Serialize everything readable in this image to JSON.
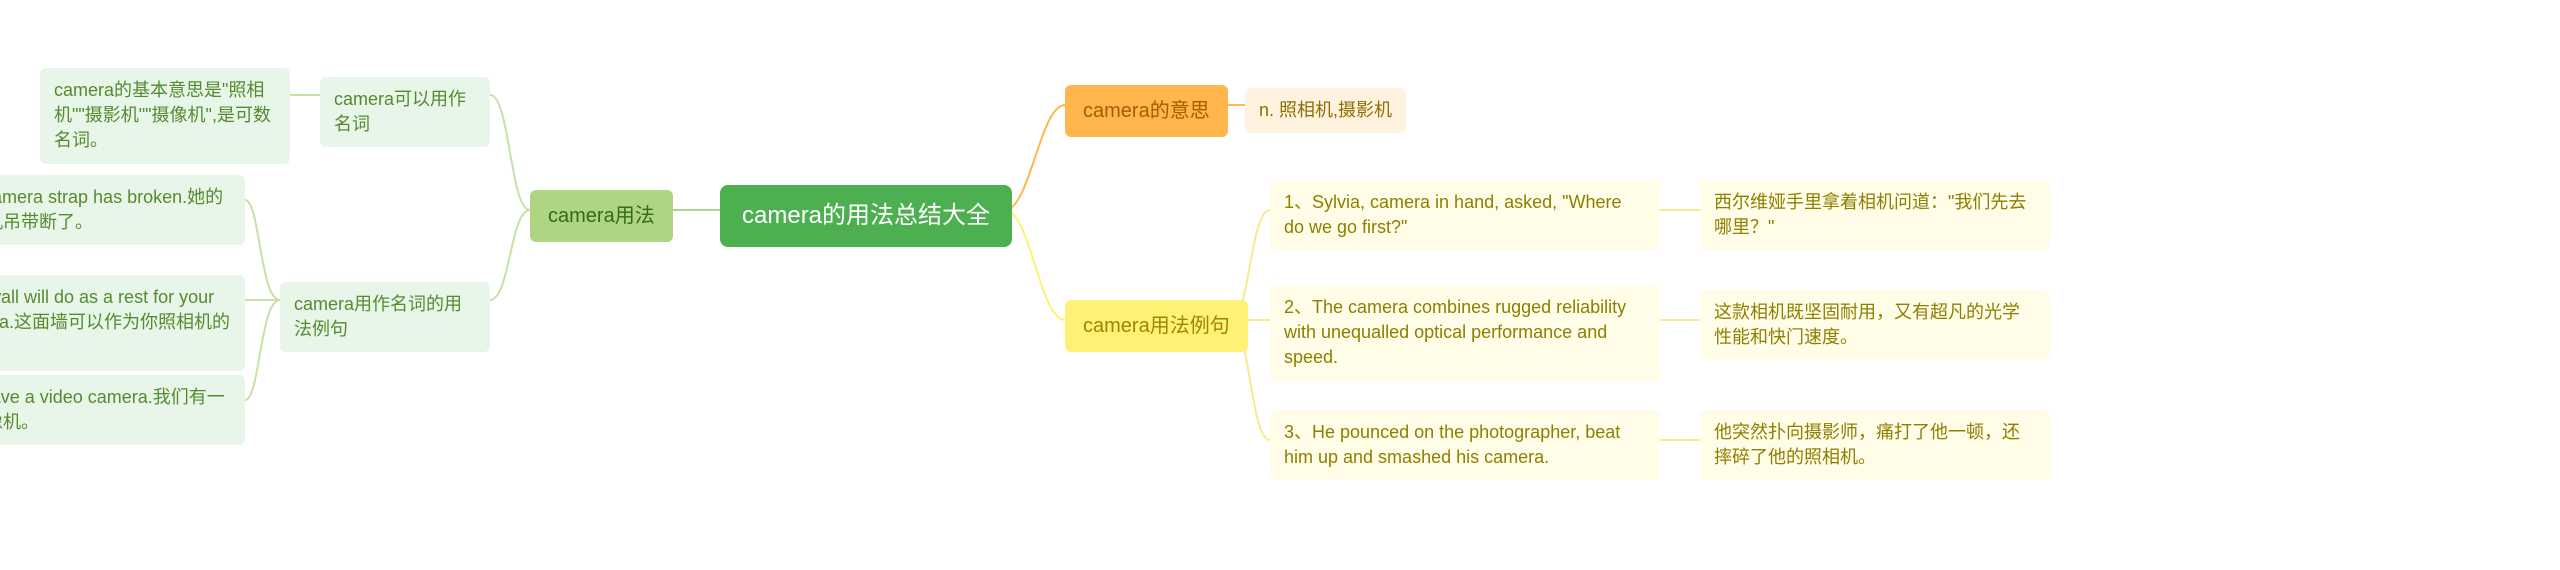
{
  "center": {
    "title": "camera的用法总结大全"
  },
  "left": {
    "usage": {
      "label": "camera用法",
      "nounLabel": "camera可以用作名词",
      "nounDesc": "camera的基本意思是\"照相机\"\"摄影机\"\"摄像机\",是可数名词。",
      "exampleBranchLabel": "camera用作名词的用法例句",
      "examples": [
        "Her camera strap has broken.她的照相机吊带断了。",
        "This wall will do as a rest for your camera.这面墙可以作为你照相机的依托。",
        "We have a video camera.我们有一架摄像机。"
      ]
    }
  },
  "right": {
    "meaning": {
      "label": "camera的意思",
      "desc": "n. 照相机,摄影机"
    },
    "examples": {
      "label": "camera用法例句",
      "items": [
        {
          "en": "1、Sylvia, camera in hand, asked, \"Where do we go first?\"",
          "zh": "西尔维娅手里拿着相机问道：\"我们先去哪里？\""
        },
        {
          "en": "2、The camera combines rugged reliability with unequalled optical performance and speed.",
          "zh": "这款相机既坚固耐用，又有超凡的光学性能和快门速度。"
        },
        {
          "en": "3、He pounced on the photographer, beat him up and smashed his camera.",
          "zh": "他突然扑向摄影师，痛打了他一顿，还摔碎了他的照相机。"
        }
      ]
    }
  },
  "chart_data": {
    "type": "mindmap",
    "root": "camera的用法总结大全",
    "branches": [
      {
        "side": "left",
        "label": "camera用法",
        "children": [
          {
            "label": "camera可以用作名词",
            "children": [
              {
                "label": "camera的基本意思是\"照相机\"\"摄影机\"\"摄像机\",是可数名词。"
              }
            ]
          },
          {
            "label": "camera用作名词的用法例句",
            "children": [
              {
                "label": "Her camera strap has broken.她的照相机吊带断了。"
              },
              {
                "label": "This wall will do as a rest for your camera.这面墙可以作为你照相机的依托。"
              },
              {
                "label": "We have a video camera.我们有一架摄像机。"
              }
            ]
          }
        ]
      },
      {
        "side": "right",
        "label": "camera的意思",
        "children": [
          {
            "label": "n. 照相机,摄影机"
          }
        ]
      },
      {
        "side": "right",
        "label": "camera用法例句",
        "children": [
          {
            "label": "1、Sylvia, camera in hand, asked, \"Where do we go first?\"",
            "children": [
              {
                "label": "西尔维娅手里拿着相机问道：\"我们先去哪里？\""
              }
            ]
          },
          {
            "label": "2、The camera combines rugged reliability with unequalled optical performance and speed.",
            "children": [
              {
                "label": "这款相机既坚固耐用，又有超凡的光学性能和快门速度。"
              }
            ]
          },
          {
            "label": "3、He pounced on the photographer, beat him up and smashed his camera.",
            "children": [
              {
                "label": "他突然扑向摄影师，痛打了他一顿，还摔碎了他的照相机。"
              }
            ]
          }
        ]
      }
    ]
  }
}
